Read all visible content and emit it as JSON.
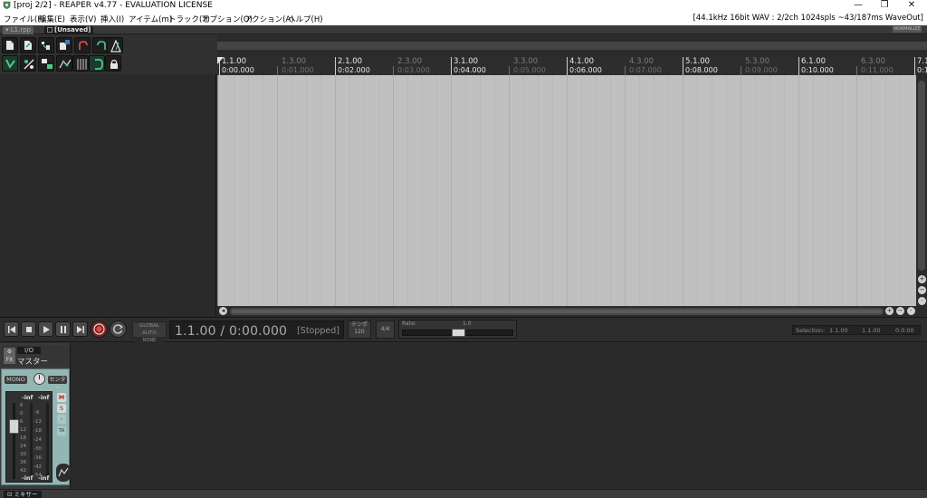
{
  "window": {
    "title": "[proj 2/2] - REAPER v4.77 - EVALUATION LICENSE",
    "controls": {
      "minimize": "—",
      "restore": "❐",
      "close": "✕"
    }
  },
  "menu": {
    "items": [
      "ファイル(F)",
      "編集(E)",
      "表示(V)",
      "挿入(I)",
      "アイテム(m)",
      "トラック(T)",
      "オプション(O)",
      "アクション(A)",
      "ヘルプ(H)"
    ],
    "status": "[44.1kHz 16bit WAV : 2/2ch 1024spls ~43/187ms WaveOut]"
  },
  "project_tabs": [
    {
      "label": "L1.rpp",
      "active": false
    },
    {
      "label": "[Unsaved]",
      "active": true
    }
  ],
  "tab_right_button": "NORMALIZE",
  "toolbar": {
    "buttons": [
      "new-project-icon",
      "open-project-icon",
      "save-project-icon",
      "project-settings-icon",
      "undo-icon",
      "redo-icon",
      "metronome-icon",
      "snap-icon",
      "ripple-edit-icon",
      "item-grouping-icon",
      "envelope-points-icon",
      "grid-icon",
      "loop-icon",
      "lock-icon"
    ]
  },
  "ruler": {
    "marks": [
      {
        "bar": "1.1.00",
        "time": "0:00.000",
        "major": true
      },
      {
        "bar": "1.3.00",
        "time": "0:01.000",
        "major": false
      },
      {
        "bar": "2.1.00",
        "time": "0:02.000",
        "major": true
      },
      {
        "bar": "2.3.00",
        "time": "0:03.000",
        "major": false
      },
      {
        "bar": "3.1.00",
        "time": "0:04.000",
        "major": true
      },
      {
        "bar": "3.3.00",
        "time": "0:05.000",
        "major": false
      },
      {
        "bar": "4.1.00",
        "time": "0:06.000",
        "major": true
      },
      {
        "bar": "4.3.00",
        "time": "0:07.000",
        "major": false
      },
      {
        "bar": "5.1.00",
        "time": "0:08.000",
        "major": true
      },
      {
        "bar": "5.3.00",
        "time": "0:09.000",
        "major": false
      },
      {
        "bar": "6.1.00",
        "time": "0:10.000",
        "major": true
      },
      {
        "bar": "6.3.00",
        "time": "0:11.000",
        "major": false
      },
      {
        "bar": "7.1",
        "time": "0:1",
        "major": true
      }
    ]
  },
  "transport": {
    "buttons": [
      "go-to-start-icon",
      "stop-icon",
      "play-icon",
      "pause-icon",
      "go-to-end-icon"
    ],
    "global_auto": {
      "title": "GLOBAL AUTO",
      "sub": "NONE"
    },
    "position": "1.1.00 / 0:00.000",
    "state": "[Stopped]",
    "tempo": {
      "label": "テンポ",
      "value": "120"
    },
    "time_signature": "4/4",
    "rate": {
      "label": "Rate:",
      "value": "1.0",
      "fraction": 0.5
    },
    "selection": {
      "label": "Selection:",
      "start": "1.1.00",
      "end": "1.1.00",
      "length": "0.0.00"
    }
  },
  "mixer": {
    "master": {
      "io_label": "I/O",
      "fx_label": "FX",
      "name": "マスター",
      "mono_label": "MONO",
      "pan_label": "センター",
      "peak_left": "-inf",
      "peak_right": "-inf",
      "bottom_left": "-inf",
      "bottom_right": "-inf",
      "fader_scale": [
        "6",
        "0",
        "6",
        "12",
        "18",
        "24",
        "30",
        "36",
        "42"
      ],
      "meter_scale": [
        "-6",
        "-12",
        "-18",
        "-24",
        "-30",
        "-36",
        "-42",
        "-54"
      ],
      "mute_label": "M",
      "solo_label": "S",
      "route_label": "◦",
      "trim_label": "TR"
    },
    "tab_label": "ミキサー"
  },
  "colors": {
    "arrange_bg": "#bfc0bf",
    "record": "#7b2121",
    "master_strip": "#93b6b4",
    "toolbar_accent": "#4ec98d"
  }
}
